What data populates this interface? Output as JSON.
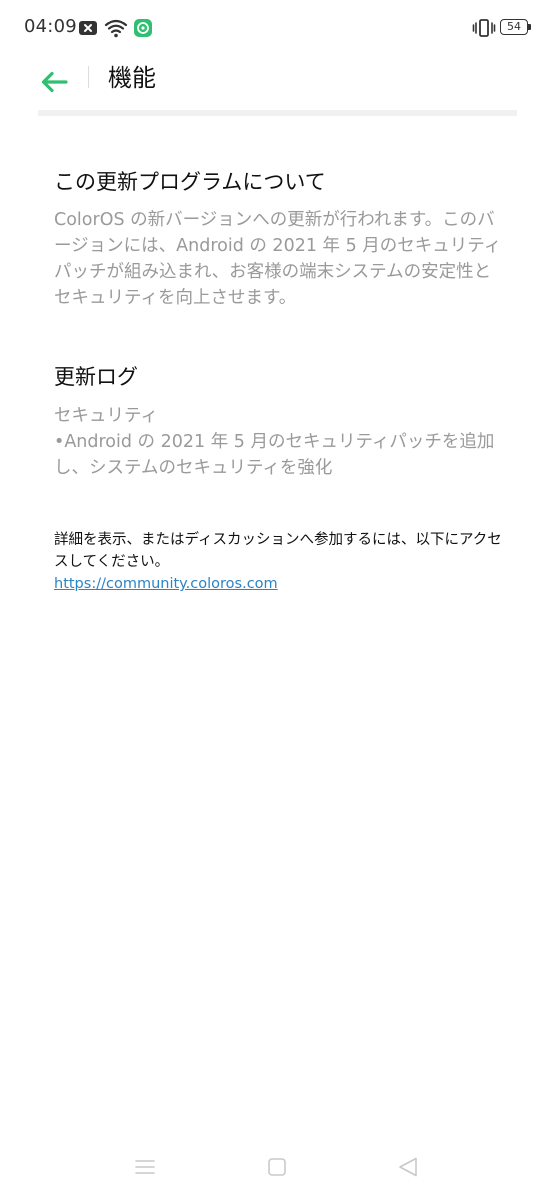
{
  "status_bar": {
    "time": "04:09",
    "battery": "54",
    "icons": [
      "close-notification-icon",
      "wifi-icon",
      "app-notification-icon",
      "vibrate-icon",
      "battery-icon"
    ]
  },
  "header": {
    "title": "機能",
    "back_icon": "arrow-left-icon",
    "accent_color": "#2fbf71"
  },
  "sections": {
    "about": {
      "heading": "この更新プログラムについて",
      "body": "ColorOS の新バージョンへの更新が行われます。このバージョンには、Android の 2021 年 5 月のセキュリティパッチが組み込まれ、お客様の端末システムの安定性とセキュリティを向上させます。"
    },
    "changelog": {
      "heading": "更新ログ",
      "category": "セキュリティ",
      "item": "•Android の 2021 年 5 月のセキュリティパッチを追加し、システムのセキュリティを強化"
    }
  },
  "more_info": {
    "text": "詳細を表示、またはディスカッションへ参加するには、以下にアクセスしてください。",
    "link": "https://community.coloros.com",
    "link_color": "#2a84c6"
  },
  "nav_bar": {
    "icons": [
      "menu-icon",
      "home-icon",
      "back-triangle-icon"
    ]
  }
}
